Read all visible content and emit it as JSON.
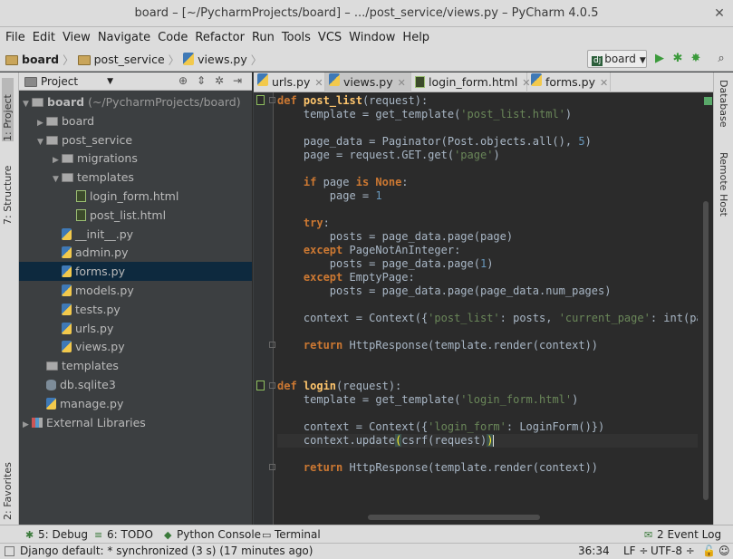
{
  "window": {
    "title": "board – [~/PycharmProjects/board] – .../post_service/views.py – PyCharm 4.0.5",
    "close_glyph": "✕"
  },
  "menu": [
    "File",
    "Edit",
    "View",
    "Navigate",
    "Code",
    "Refactor",
    "Run",
    "Tools",
    "VCS",
    "Window",
    "Help"
  ],
  "breadcrumb": [
    "board",
    "post_service",
    "views.py"
  ],
  "run_config": {
    "badge": "dj",
    "label": "board"
  },
  "left_tabs": {
    "project": "1: Project",
    "structure": "7: Structure",
    "favorites": "2: Favorites"
  },
  "right_tabs": {
    "database": "Database",
    "remote": "Remote Host"
  },
  "project_panel": {
    "view_label": "Project",
    "tree": [
      {
        "label": "board",
        "suffix": " (~/PycharmProjects/board)",
        "type": "folder",
        "expand": "▼",
        "depth": 0
      },
      {
        "label": "board",
        "type": "folder",
        "expand": "▶",
        "depth": 1
      },
      {
        "label": "post_service",
        "type": "folder",
        "expand": "▼",
        "depth": 1
      },
      {
        "label": "migrations",
        "type": "folder",
        "expand": "▶",
        "depth": 2
      },
      {
        "label": "templates",
        "type": "folder",
        "expand": "▼",
        "depth": 2
      },
      {
        "label": "login_form.html",
        "type": "html",
        "expand": "",
        "depth": 3
      },
      {
        "label": "post_list.html",
        "type": "html",
        "expand": "",
        "depth": 3
      },
      {
        "label": "__init__.py",
        "type": "py",
        "expand": "",
        "depth": 2
      },
      {
        "label": "admin.py",
        "type": "py",
        "expand": "",
        "depth": 2
      },
      {
        "label": "forms.py",
        "type": "py",
        "expand": "",
        "depth": 2,
        "selected": true
      },
      {
        "label": "models.py",
        "type": "py",
        "expand": "",
        "depth": 2
      },
      {
        "label": "tests.py",
        "type": "py",
        "expand": "",
        "depth": 2
      },
      {
        "label": "urls.py",
        "type": "py",
        "expand": "",
        "depth": 2
      },
      {
        "label": "views.py",
        "type": "py",
        "expand": "",
        "depth": 2
      },
      {
        "label": "templates",
        "type": "folder",
        "expand": "",
        "depth": 1
      },
      {
        "label": "db.sqlite3",
        "type": "db",
        "expand": "",
        "depth": 1
      },
      {
        "label": "manage.py",
        "type": "py",
        "expand": "",
        "depth": 1
      },
      {
        "label": "External Libraries",
        "type": "lib",
        "expand": "▶",
        "depth": 0
      }
    ]
  },
  "editor_tabs": [
    {
      "label": "urls.py",
      "type": "py"
    },
    {
      "label": "views.py",
      "type": "py",
      "active": true
    },
    {
      "label": "login_form.html",
      "type": "html"
    },
    {
      "label": "forms.py",
      "type": "py"
    }
  ],
  "code_lines": [
    {
      "line": 0,
      "tokens": [
        [
          "kw",
          "def "
        ],
        [
          "fn",
          "post_list"
        ],
        [
          "",
          "(request):"
        ]
      ]
    },
    {
      "line": 1,
      "tokens": [
        [
          "",
          "    template = get_template("
        ],
        [
          "st",
          "'post_list.html'"
        ],
        [
          "",
          ")"
        ]
      ]
    },
    {
      "line": 3,
      "tokens": [
        [
          "",
          "    page_data = Paginator(Post.objects.all(), "
        ],
        [
          "nm",
          "5"
        ],
        [
          "",
          ")"
        ]
      ]
    },
    {
      "line": 4,
      "tokens": [
        [
          "",
          "    page = request.GET.get("
        ],
        [
          "st",
          "'page'"
        ],
        [
          "",
          ")"
        ]
      ]
    },
    {
      "line": 6,
      "tokens": [
        [
          "",
          "    "
        ],
        [
          "kw",
          "if "
        ],
        [
          "",
          "page "
        ],
        [
          "kw",
          "is None"
        ],
        [
          "",
          ":"
        ]
      ]
    },
    {
      "line": 7,
      "tokens": [
        [
          "",
          "        page = "
        ],
        [
          "nm",
          "1"
        ]
      ]
    },
    {
      "line": 9,
      "tokens": [
        [
          "",
          "    "
        ],
        [
          "kw",
          "try"
        ],
        [
          "",
          ":"
        ]
      ]
    },
    {
      "line": 10,
      "tokens": [
        [
          "",
          "        posts = page_data.page(page)"
        ]
      ]
    },
    {
      "line": 11,
      "tokens": [
        [
          "",
          "    "
        ],
        [
          "kw",
          "except "
        ],
        [
          "",
          "PageNotAnInteger:"
        ]
      ]
    },
    {
      "line": 12,
      "tokens": [
        [
          "",
          "        posts = page_data.page("
        ],
        [
          "nm",
          "1"
        ],
        [
          "",
          ")"
        ]
      ]
    },
    {
      "line": 13,
      "tokens": [
        [
          "",
          "    "
        ],
        [
          "kw",
          "except "
        ],
        [
          "",
          "EmptyPage:"
        ]
      ]
    },
    {
      "line": 14,
      "tokens": [
        [
          "",
          "        posts = page_data.page(page_data.num_pages)"
        ]
      ]
    },
    {
      "line": 16,
      "tokens": [
        [
          "",
          "    context = Context({"
        ],
        [
          "st",
          "'post_list'"
        ],
        [
          "",
          ": posts, "
        ],
        [
          "st",
          "'current_page'"
        ],
        [
          "",
          ": int(page),"
        ]
      ]
    },
    {
      "line": 18,
      "tokens": [
        [
          "",
          "    "
        ],
        [
          "kw",
          "return "
        ],
        [
          "",
          "HttpResponse(template.render(context))"
        ]
      ]
    },
    {
      "line": 21,
      "tokens": [
        [
          "kw",
          "def "
        ],
        [
          "fn",
          "login"
        ],
        [
          "",
          "(request):"
        ]
      ]
    },
    {
      "line": 22,
      "tokens": [
        [
          "",
          "    template = get_template("
        ],
        [
          "st",
          "'login_form.html'"
        ],
        [
          "",
          ")"
        ]
      ]
    },
    {
      "line": 24,
      "tokens": [
        [
          "",
          "    context = Context({"
        ],
        [
          "st",
          "'login_form'"
        ],
        [
          "",
          ": LoginForm()})"
        ]
      ]
    },
    {
      "line": 25,
      "tokens": [
        [
          "",
          "    context.update"
        ],
        [
          "br",
          "("
        ],
        [
          "",
          "csrf(request)"
        ],
        [
          "br",
          ")"
        ]
      ],
      "current": true
    },
    {
      "line": 27,
      "tokens": [
        [
          "",
          "    "
        ],
        [
          "kw",
          "return "
        ],
        [
          "",
          "HttpResponse(template.render(context))"
        ]
      ]
    }
  ],
  "tool_windows": [
    {
      "label": "5: Debug",
      "icon": "✱"
    },
    {
      "label": "6: TODO",
      "icon": "≡"
    },
    {
      "label": "Python Console",
      "icon": "◆"
    },
    {
      "label": "Terminal",
      "icon": "▭"
    },
    {
      "label": "2 Event Log",
      "icon": "✉"
    }
  ],
  "status": {
    "message": "Django default: * synchronized (3 s) (17 minutes ago)",
    "position": "36:34",
    "line_sep": "LF ÷",
    "encoding": "UTF-8 ÷"
  },
  "colors": {
    "keyword": "#cc7832",
    "string": "#6a8759",
    "number": "#6897bb",
    "function": "#ffc66d",
    "selection": "#0d293e"
  }
}
